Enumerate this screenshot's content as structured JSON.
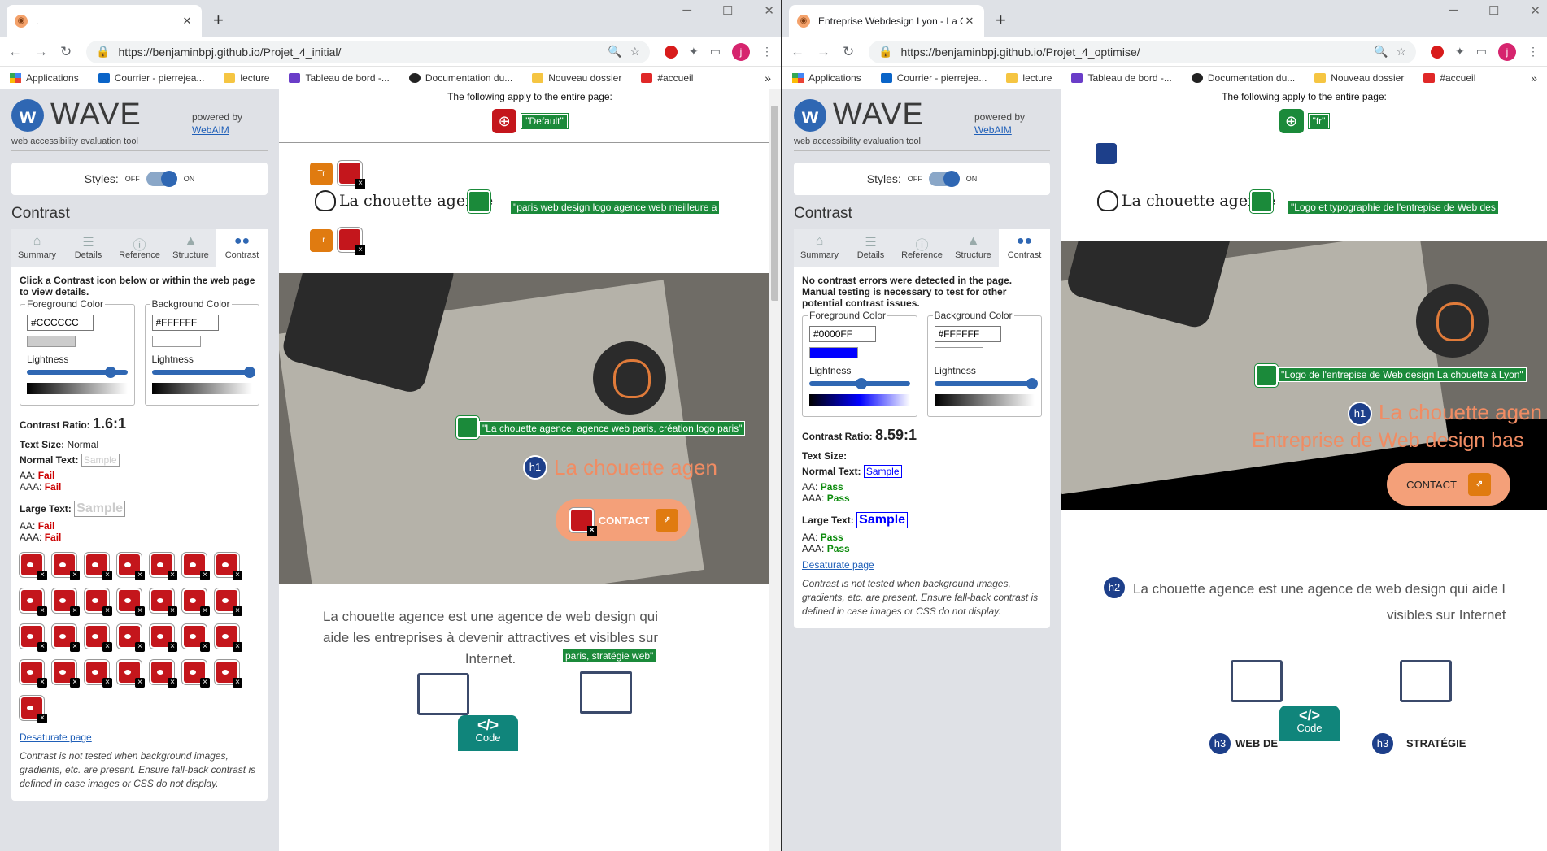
{
  "left": {
    "tab_title": ".",
    "url": "https://benjaminbpj.github.io/Projet_4_initial/",
    "wave": {
      "logo": "WAVE",
      "tagline": "web accessibility evaluation tool",
      "powered_by": "powered by",
      "webaim": "WebAIM",
      "styles_label": "Styles:",
      "off": "OFF",
      "on": "ON",
      "panel_title": "Contrast",
      "tabs": [
        "Summary",
        "Details",
        "Reference",
        "Structure",
        "Contrast"
      ],
      "instructions": "Click a Contrast icon below or within the web page to view details.",
      "fg_legend": "Foreground Color",
      "fg_value": "#CCCCCC",
      "fg_color": "#cccccc",
      "bg_legend": "Background Color",
      "bg_value": "#FFFFFF",
      "bg_color": "#ffffff",
      "lightness": "Lightness",
      "ratio_label": "Contrast Ratio:",
      "ratio_value": "1.6:1",
      "text_size_label": "Text Size:",
      "text_size_value": "Normal",
      "normal_text": "Normal Text:",
      "large_text": "Large Text:",
      "sample": "Sample",
      "aa": "AA:",
      "aaa": "AAA:",
      "normal_aa": "Fail",
      "normal_aaa": "Fail",
      "large_aa": "Fail",
      "large_aaa": "Fail",
      "error_count": 29,
      "desaturate": "Desaturate page",
      "note": "Contrast is not tested when background images, gradients, etc. are present. Ensure fall-back contrast is defined in case images or CSS do not display."
    },
    "page": {
      "applies": "The following apply to the entire page:",
      "lang_label": "\"Default\"",
      "logo_text": "La chouette agence",
      "warn_icon_text": "Tr",
      "alt1": "\"paris web design logo agence web meilleure a",
      "alt2": "\"La chouette agence, agence web paris, création logo paris\"",
      "h1_badge": "h1",
      "h1_text": "La chouette agen",
      "contact": "CONTACT",
      "intro": "La chouette agence est une agence de web design qui aide les entreprises à devenir attractives et visibles sur Internet.",
      "alt3": "paris, stratégie web\"",
      "code_badge": "Code",
      "code_glyph": "</>"
    }
  },
  "right": {
    "tab_title": "Entreprise Webdesign Lyon - La C",
    "url": "https://benjaminbpj.github.io/Projet_4_optimise/",
    "wave": {
      "logo": "WAVE",
      "tagline": "web accessibility evaluation tool",
      "powered_by": "powered by",
      "webaim": "WebAIM",
      "styles_label": "Styles:",
      "off": "OFF",
      "on": "ON",
      "panel_title": "Contrast",
      "tabs": [
        "Summary",
        "Details",
        "Reference",
        "Structure",
        "Contrast"
      ],
      "instructions": "No contrast errors were detected in the page. Manual testing is necessary to test for other potential contrast issues.",
      "fg_legend": "Foreground Color",
      "fg_value": "#0000FF",
      "fg_color": "#0000ff",
      "bg_legend": "Background Color",
      "bg_value": "#FFFFFF",
      "bg_color": "#ffffff",
      "lightness": "Lightness",
      "ratio_label": "Contrast Ratio:",
      "ratio_value": "8.59:1",
      "text_size_label": "Text Size:",
      "normal_text": "Normal Text:",
      "large_text": "Large Text:",
      "sample": "Sample",
      "aa": "AA:",
      "aaa": "AAA:",
      "normal_aa": "Pass",
      "normal_aaa": "Pass",
      "large_aa": "Pass",
      "large_aaa": "Pass",
      "desaturate": "Desaturate page",
      "note": "Contrast is not tested when background images, gradients, etc. are present. Ensure fall-back contrast is defined in case images or CSS do not display."
    },
    "page": {
      "applies": "The following apply to the entire page:",
      "lang_label": "\"fr\"",
      "logo_text": "La chouette agence",
      "alt1": "\"Logo et typographie de l'entrepise de Web des",
      "alt2": "\"Logo de l'entrepise de Web design La chouette à Lyon\"",
      "h1_badge": "h1",
      "h1_text": "La chouette agen",
      "h1_sub": "Entreprise de Web design bas",
      "contact": "CONTACT",
      "h2_badge": "h2",
      "intro1": "La chouette agence est une agence de web design qui aide l",
      "intro2": "visibles sur Internet",
      "h3_badge": "h3",
      "h3a": "WEB DE",
      "h3b": "STRATÉGIE",
      "code_badge": "Code",
      "code_glyph": "</>"
    }
  },
  "shared": {
    "new_tab": "+",
    "bookmarks": [
      "Applications",
      "Courrier - pierrejea...",
      "lecture",
      "Tableau de bord -...",
      "Documentation du...",
      "Nouveau dossier",
      "#accueil"
    ],
    "more": "»"
  }
}
